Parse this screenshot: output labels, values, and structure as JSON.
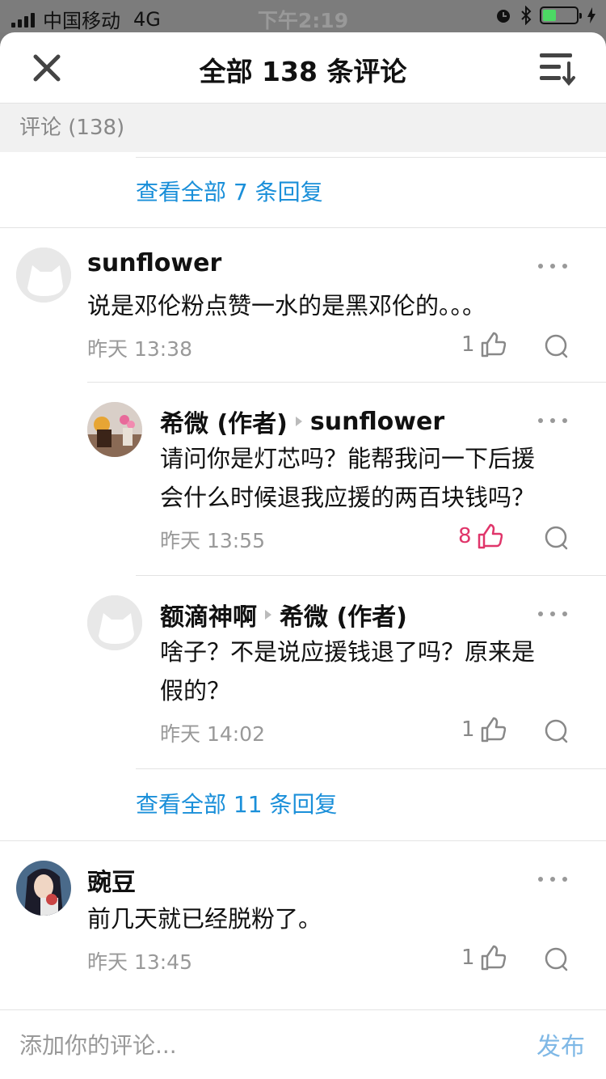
{
  "status": {
    "carrier": "中国移动",
    "network": "4G",
    "time": "下午2:19"
  },
  "header": {
    "title": "全部 138 条评论"
  },
  "section": {
    "label": "评论 (138)"
  },
  "links": {
    "view_replies_1": "查看全部 7 条回复",
    "view_replies_2": "查看全部 11 条回复"
  },
  "comments": [
    {
      "name": "sunflower",
      "text": "说是邓伦粉点赞一水的是黑邓伦的。。。",
      "time": "昨天 13:38",
      "likes": "1"
    },
    {
      "name": "希微 (作者)",
      "reply_to": "sunflower",
      "text_line1": "请问你是灯芯吗？能帮我问一下后援",
      "text_line2": "会什么时候退我应援的两百块钱吗？",
      "time": "昨天 13:55",
      "likes": "8"
    },
    {
      "name": "额滴神啊",
      "reply_to": "希微 (作者)",
      "text_line1": "啥子？不是说应援钱退了吗？原来是",
      "text_line2": "假的？",
      "time": "昨天 14:02",
      "likes": "1"
    },
    {
      "name": "豌豆",
      "text": "前几天就已经脱粉了。",
      "time": "昨天 13:45",
      "likes": "1"
    }
  ],
  "footer": {
    "placeholder": "添加你的评论...",
    "post_label": "发布"
  },
  "colors": {
    "link": "#1a8fd9",
    "hot_like": "#e0356a",
    "post": "#7fb8e6"
  }
}
